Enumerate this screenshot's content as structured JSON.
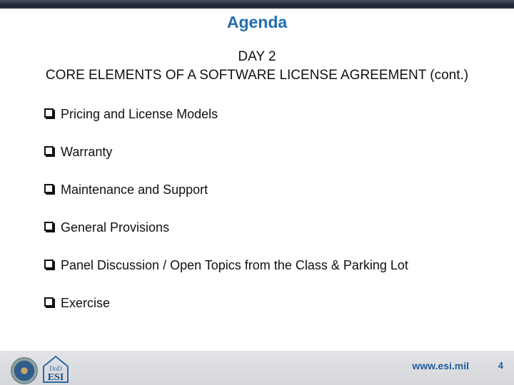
{
  "slide": {
    "title": "Agenda",
    "subtitle_line1": "DAY 2",
    "subtitle_line2": "CORE ELEMENTS OF A SOFTWARE LICENSE AGREEMENT (cont.)",
    "items": [
      {
        "label": "Pricing and License Models",
        "icon": "checkbox-bullet-icon"
      },
      {
        "label": "Warranty",
        "icon": "checkbox-bullet-icon"
      },
      {
        "label": "Maintenance and Support",
        "icon": "checkbox-bullet-icon"
      },
      {
        "label": "General Provisions",
        "icon": "checkbox-bullet-icon"
      },
      {
        "label": "Panel Discussion / Open Topics from the Class & Parking Lot",
        "icon": "checkbox-bullet-icon"
      },
      {
        "label": "Exercise",
        "icon": "checkbox-bullet-icon"
      }
    ]
  },
  "footer": {
    "logo_esi_top": "DoD",
    "logo_esi_bottom": "ESI",
    "url": "www.esi.mil",
    "page_number": "4"
  },
  "colors": {
    "title": "#1f6fb0",
    "footer_text": "#1f5c9a",
    "top_bar": "#1f2633"
  }
}
